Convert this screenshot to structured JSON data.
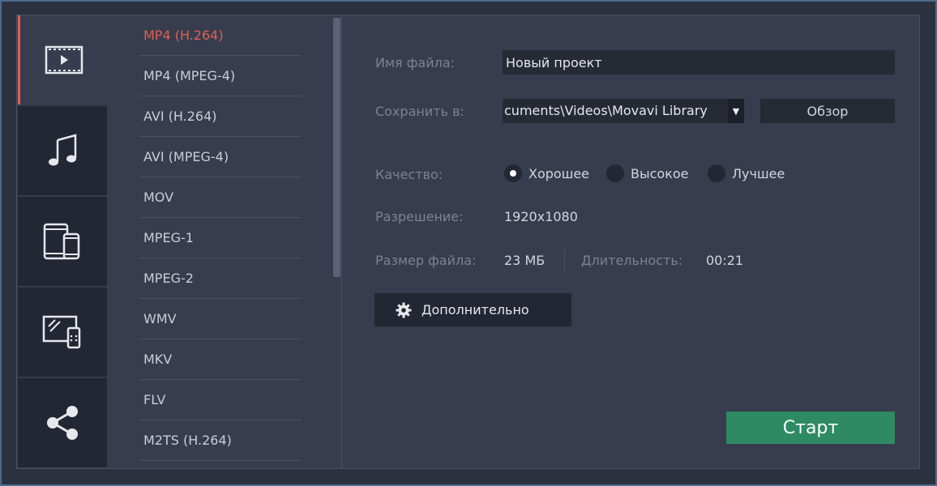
{
  "categories": [
    {
      "name": "video",
      "icon": "video-film-icon",
      "active": true
    },
    {
      "name": "audio",
      "icon": "music-note-icon",
      "active": false
    },
    {
      "name": "devices",
      "icon": "mobile-devices-icon",
      "active": false
    },
    {
      "name": "tv",
      "icon": "tv-devices-icon",
      "active": false
    },
    {
      "name": "share",
      "icon": "share-icon",
      "active": false
    }
  ],
  "formats": [
    "MP4 (H.264)",
    "MP4 (MPEG-4)",
    "AVI (H.264)",
    "AVI (MPEG-4)",
    "MOV",
    "MPEG-1",
    "MPEG-2",
    "WMV",
    "MKV",
    "FLV",
    "M2TS (H.264)"
  ],
  "selected_format": "MP4 (H.264)",
  "settings": {
    "filename_label": "Имя файла:",
    "filename_value": "Новый проект",
    "save_to_label": "Сохранить в:",
    "save_to_value": "cuments\\Videos\\Movavi Library",
    "dropdown_arrow": "▼",
    "browse_label": "Обзор",
    "quality_label": "Качество:",
    "quality_options": [
      "Хорошее",
      "Высокое",
      "Лучшее"
    ],
    "quality_selected": "Хорошее",
    "resolution_label": "Разрешение:",
    "resolution_value": "1920x1080",
    "filesize_label": "Размер файла:",
    "filesize_value": "23 МБ",
    "duration_label": "Длительность:",
    "duration_value": "00:21",
    "advanced_label": "Дополнительно",
    "start_label": "Старт"
  },
  "colors": {
    "accent": "#e0604f",
    "start": "#2e8a63",
    "panel": "#373d4e",
    "dark": "#232733"
  }
}
